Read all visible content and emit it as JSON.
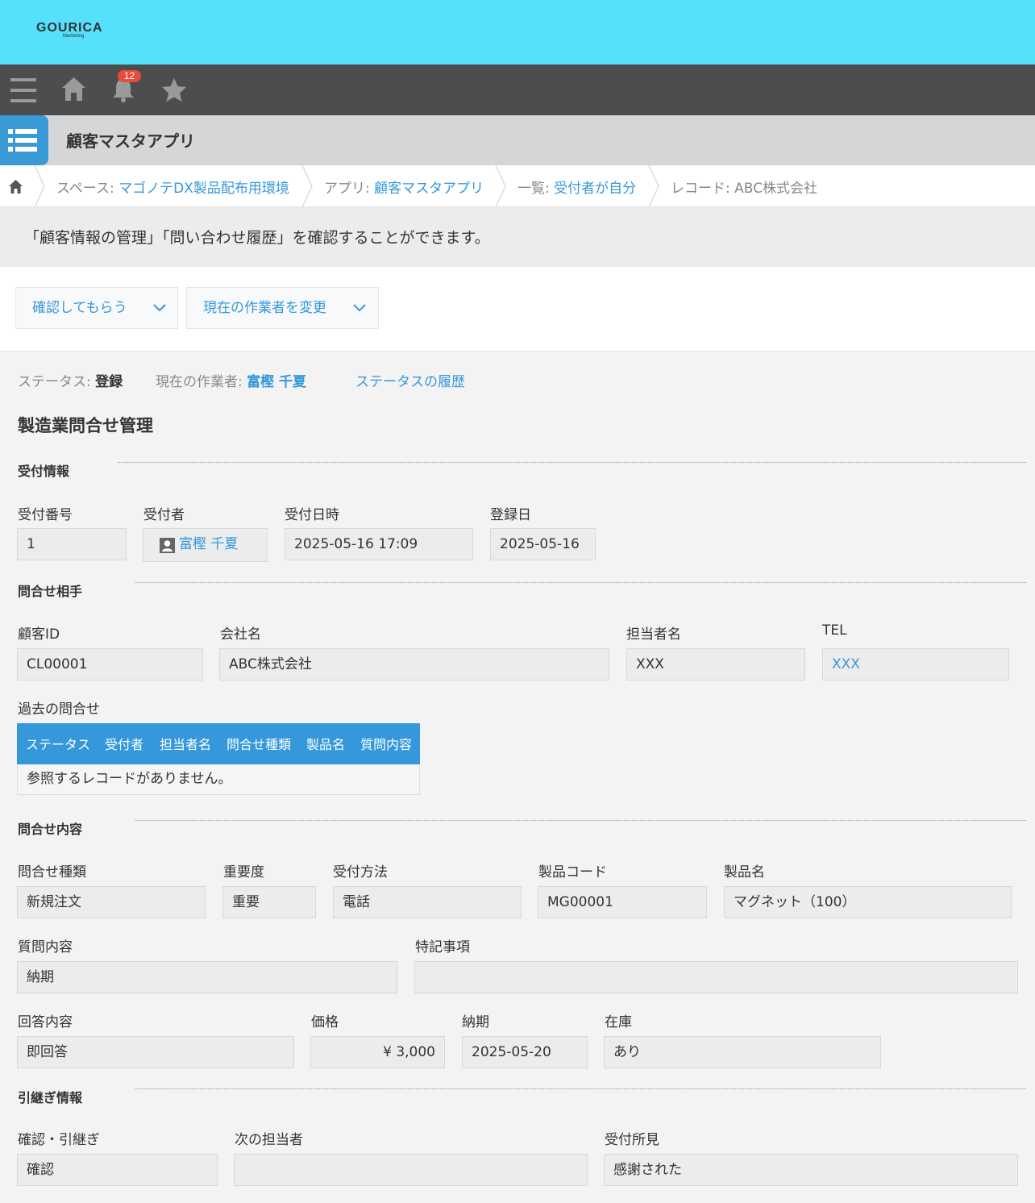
{
  "header": {
    "logo": "GOURICA",
    "logo_sub": "Marketing"
  },
  "navbar": {
    "notification_count": "12"
  },
  "app": {
    "title": "顧客マスタアプリ"
  },
  "breadcrumb": {
    "space_prefix": "スペース: ",
    "space_name": "マゴノテDX製品配布用環境",
    "app_prefix": "アプリ: ",
    "app_name": "顧客マスタアプリ",
    "view_prefix": "一覧: ",
    "view_name": "受付者が自分",
    "record_text": "レコード: ABC株式会社"
  },
  "description": "「顧客情報の管理」「問い合わせ履歴」を確認することができます。",
  "actions": {
    "confirm": "確認してもらう",
    "change_assignee": "現在の作業者を変更"
  },
  "status": {
    "status_label": "ステータス: ",
    "status_value": "登録",
    "assignee_label": "現在の作業者: ",
    "assignee_value": "富樫 千夏",
    "history_link": "ステータスの履歴"
  },
  "form": {
    "title": "製造業問合せ管理",
    "sections": {
      "reception": "受付情報",
      "contact": "問合せ相手",
      "inquiry": "問合せ内容",
      "handover": "引継ぎ情報"
    },
    "fields": {
      "reception_no": {
        "label": "受付番号",
        "value": "1"
      },
      "receiver": {
        "label": "受付者",
        "value": "富樫 千夏"
      },
      "reception_datetime": {
        "label": "受付日時",
        "value": "2025-05-16 17:09"
      },
      "registered_date": {
        "label": "登録日",
        "value": "2025-05-16"
      },
      "customer_id": {
        "label": "顧客ID",
        "value": "CL00001"
      },
      "company": {
        "label": "会社名",
        "value": "ABC株式会社"
      },
      "contact_person": {
        "label": "担当者名",
        "value": "XXX"
      },
      "tel": {
        "label": "TEL",
        "value": "XXX"
      },
      "inquiry_type": {
        "label": "問合せ種類",
        "value": "新規注文"
      },
      "importance": {
        "label": "重要度",
        "value": "重要"
      },
      "method": {
        "label": "受付方法",
        "value": "電話"
      },
      "product_code": {
        "label": "製品コード",
        "value": "MG00001"
      },
      "product_name": {
        "label": "製品名",
        "value": "マグネット（100）"
      },
      "question": {
        "label": "質問内容",
        "value": "納期"
      },
      "notes": {
        "label": "特記事項",
        "value": ""
      },
      "answer": {
        "label": "回答内容",
        "value": "即回答"
      },
      "price": {
        "label": "価格",
        "value": "¥ 3,000"
      },
      "delivery": {
        "label": "納期",
        "value": "2025-05-20"
      },
      "stock": {
        "label": "在庫",
        "value": "あり"
      },
      "confirm_handover": {
        "label": "確認・引継ぎ",
        "value": "確認"
      },
      "next_person": {
        "label": "次の担当者",
        "value": ""
      },
      "reception_opinion": {
        "label": "受付所見",
        "value": "感謝された"
      }
    },
    "past_inquiries": {
      "label": "過去の問合せ",
      "columns": [
        "ステータス",
        "受付者",
        "担当者名",
        "問合せ種類",
        "製品名",
        "質問内容"
      ],
      "empty": "参照するレコードがありません。"
    }
  },
  "colors": {
    "topbar": "#55e0fb",
    "navbar": "#4d4d4d",
    "accent": "#3498db",
    "badge": "#e74c3c"
  }
}
